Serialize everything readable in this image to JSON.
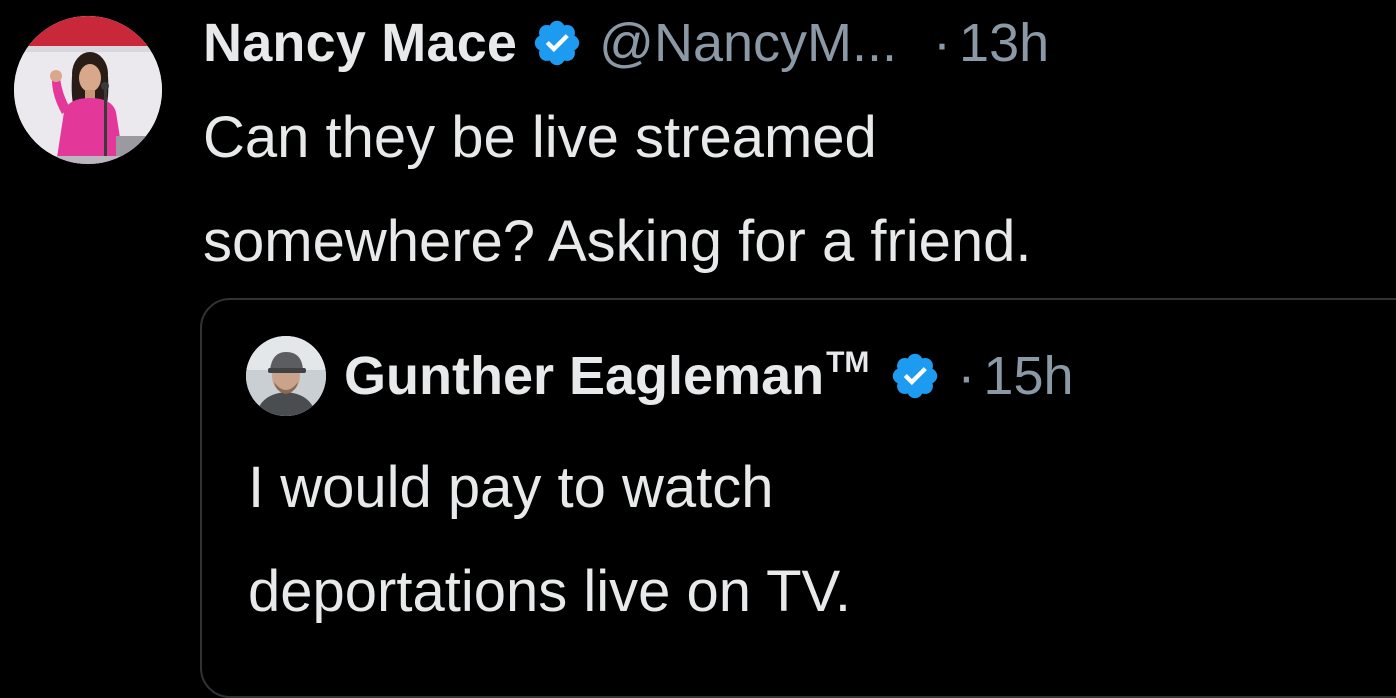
{
  "tweet": {
    "author": {
      "display_name": "Nancy Mace",
      "handle": "@NancyM...",
      "verified": true,
      "avatar": "avatar-photo"
    },
    "separator": "·",
    "time": "13h",
    "text_lines": [
      "Can they be live streamed",
      "somewhere? Asking for a friend."
    ]
  },
  "quoted_tweet": {
    "author": {
      "display_name": "Gunther Eagleman",
      "trademark": "TM",
      "verified": true,
      "avatar": "avatar-photo"
    },
    "separator": "·",
    "time": "15h",
    "text_lines": [
      "I would pay to watch",
      "deportations live on TV."
    ]
  },
  "colors": {
    "background": "#000000",
    "primary_text": "#e7e9ea",
    "secondary_text": "#8b98a5",
    "verified_badge": "#1d9bf0",
    "card_border": "#2f3336"
  },
  "icons": {
    "verified": "verified-badge-icon"
  }
}
